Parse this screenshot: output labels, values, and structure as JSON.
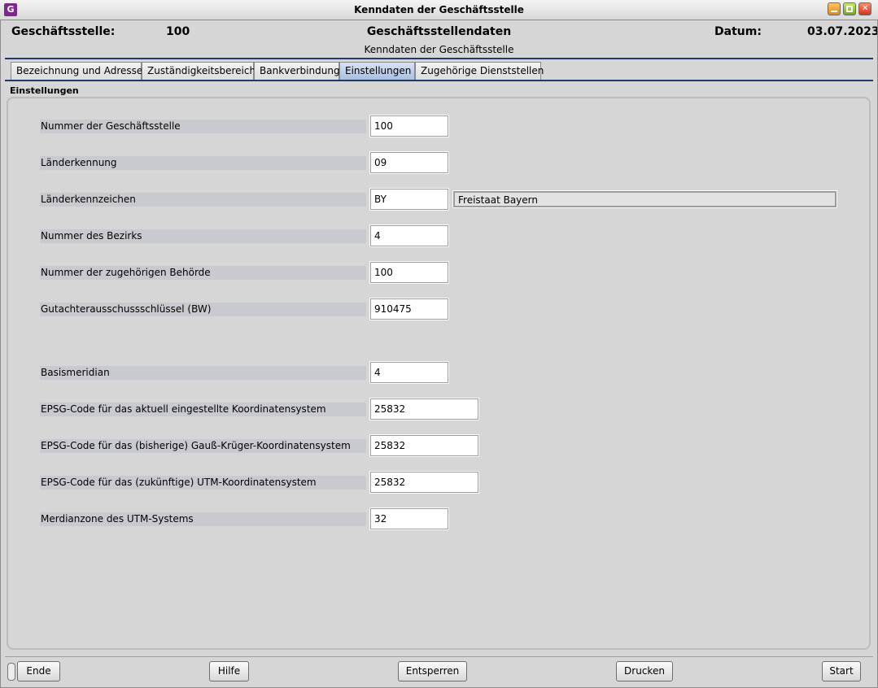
{
  "window": {
    "title": "Kenndaten der Geschäftsstelle",
    "icon": "app-g-icon"
  },
  "header": {
    "office_label": "Geschäftsstelle:",
    "office_value": "100",
    "section_title": "Geschäftsstellendaten",
    "date_label": "Datum:",
    "date_value": "03.07.2023",
    "subtitle": "Kenndaten der Geschäftsstelle"
  },
  "tabs": [
    {
      "label": "Bezeichnung und Adresse",
      "active": false
    },
    {
      "label": "Zuständigkeitsbereich",
      "active": false
    },
    {
      "label": "Bankverbindung",
      "active": false
    },
    {
      "label": "Einstellungen",
      "active": true
    },
    {
      "label": "Zugehörige Dienststellen",
      "active": false
    }
  ],
  "panel": {
    "title": "Einstellungen",
    "fields": [
      {
        "label": "Nummer der Geschäftsstelle",
        "value": "100"
      },
      {
        "label": "Länderkennung",
        "value": "09"
      },
      {
        "label": "Länderkennzeichen",
        "value": "BY",
        "extra": "Freistaat Bayern"
      },
      {
        "label": "Nummer des Bezirks",
        "value": "4"
      },
      {
        "label": "Nummer der zugehörigen Behörde",
        "value": "100"
      },
      {
        "label": "Gutachterausschussschlüssel (BW)",
        "value": "910475"
      },
      {
        "label": "Basismeridian",
        "value": "4"
      },
      {
        "label": "EPSG-Code für das aktuell eingestellte Koordinatensystem",
        "value": "25832"
      },
      {
        "label": "EPSG-Code für das (bisherige) Gauß-Krüger-Koordinatensystem",
        "value": "25832"
      },
      {
        "label": "EPSG-Code für das (zukünftige) UTM-Koordinatensystem",
        "value": "25832"
      },
      {
        "label": "Merdianzone des UTM-Systems",
        "value": "32"
      }
    ]
  },
  "footer": {
    "buttons": [
      "Ende",
      "Hilfe",
      "Entsperren",
      "Drucken",
      "Start"
    ]
  }
}
